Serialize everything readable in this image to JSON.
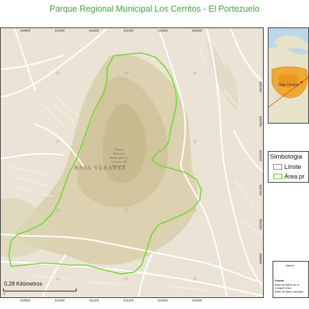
{
  "title": "Parque Regional Municipal Los Cerritos - El Portezuelo",
  "map": {
    "region_label": "BAJA VERAPAZ",
    "park_label_lines": [
      "Parque",
      "Regional",
      "Municipal Los",
      "Cerritos - El",
      "Portezuelo"
    ],
    "x_ticks_top": [
      "520800",
      "521000",
      "521200",
      "521400",
      "521600",
      "521800"
    ],
    "x_ticks_bottom": [
      "520800",
      "521000",
      "521200",
      "521400",
      "521600",
      "521800"
    ],
    "y_ticks_right": [
      "1661800",
      "1661600",
      "1661400",
      "1661200",
      "1661000",
      "1660800"
    ],
    "scale": {
      "label": "0.28 Kilómetros",
      "ticks": [
        "0"
      ]
    },
    "colors": {
      "base": "#ebe4d6",
      "relief": "#d8cfae",
      "boundary": "#66dd22",
      "roads": "#ffffff"
    }
  },
  "inset": {
    "label": "Baja Verapaz",
    "colors": {
      "water": "#bcd7e8",
      "land": "#e8e2c8",
      "department": "#f0a830",
      "marker": "#cc2222"
    }
  },
  "legend": {
    "title": "Simbologia",
    "items": [
      {
        "label": "Límite",
        "color": "#ffffff",
        "border": "#888888"
      },
      {
        "label": "Área pr",
        "color": "#ffffff",
        "border": "#66dd22"
      }
    ]
  },
  "info": {
    "heading": "Sistem",
    "source_label": "Fuente:",
    "lines": [
      "Base de datos de la",
      "CONAP 2016",
      "Base de datos cartogra"
    ]
  }
}
